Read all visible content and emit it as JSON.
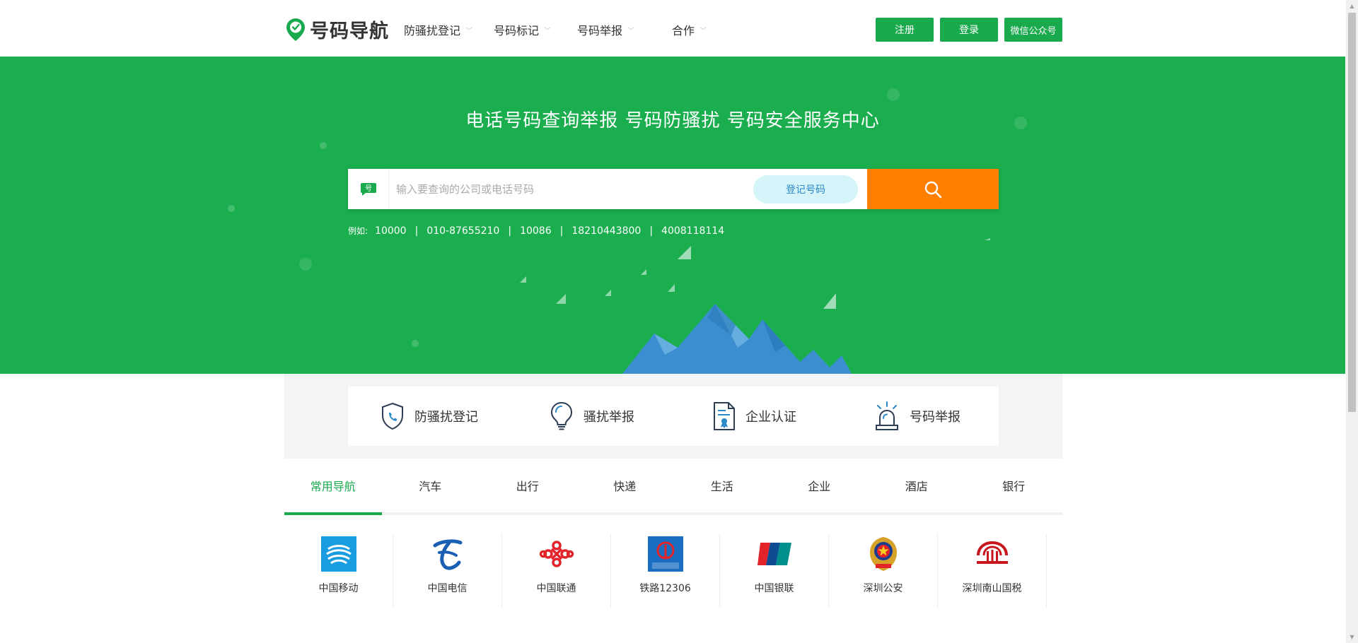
{
  "header": {
    "logo_text": "号码导航",
    "nav": [
      {
        "label": "防骚扰登记"
      },
      {
        "label": "号码标记"
      },
      {
        "label": "号码举报"
      },
      {
        "label": "合作"
      }
    ],
    "buttons": {
      "register": "注册",
      "login": "登录",
      "wechat": "微信公众号"
    }
  },
  "hero": {
    "title": "电话号码查询举报 号码防骚扰 号码安全服务中心",
    "search": {
      "placeholder": "输入要查询的公司或电话号码",
      "register_number_label": "登记号码"
    },
    "examples": {
      "label": "例如:",
      "items": [
        "10000",
        "010-87655210",
        "10086",
        "18210443800",
        "4008118114"
      ]
    }
  },
  "features": [
    {
      "label": "防骚扰登记",
      "icon": "shield-phone-icon"
    },
    {
      "label": "骚扰举报",
      "icon": "lightbulb-icon"
    },
    {
      "label": "企业认证",
      "icon": "certificate-icon"
    },
    {
      "label": "号码举报",
      "icon": "alarm-light-icon"
    }
  ],
  "tabs": [
    {
      "label": "常用导航",
      "active": true
    },
    {
      "label": "汽车"
    },
    {
      "label": "出行"
    },
    {
      "label": "快递"
    },
    {
      "label": "生活"
    },
    {
      "label": "企业"
    },
    {
      "label": "酒店"
    },
    {
      "label": "银行"
    }
  ],
  "nav_grid": [
    {
      "label": "中国移动",
      "icon": "china-mobile-logo-icon"
    },
    {
      "label": "中国电信",
      "icon": "china-telecom-logo-icon"
    },
    {
      "label": "中国联通",
      "icon": "china-unicom-logo-icon"
    },
    {
      "label": "铁路12306",
      "icon": "railway-12306-logo-icon"
    },
    {
      "label": "中国银联",
      "icon": "unionpay-logo-icon"
    },
    {
      "label": "深圳公安",
      "icon": "police-emblem-icon"
    },
    {
      "label": "深圳南山国税",
      "icon": "tax-bureau-logo-icon"
    }
  ],
  "colors": {
    "brand_green": "#1aae4f",
    "search_orange": "#ff7f00",
    "active_tab": "#1aaa4e"
  }
}
